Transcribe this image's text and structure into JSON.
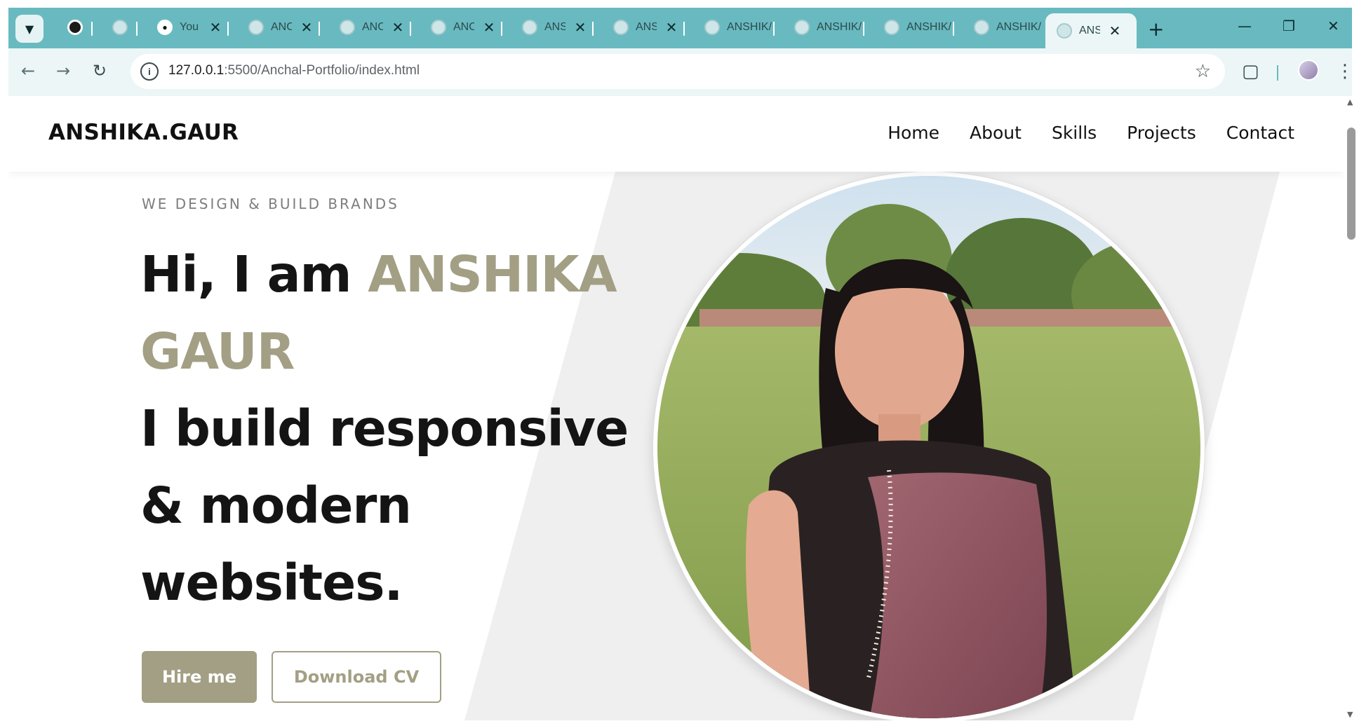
{
  "browser": {
    "tabs": [
      {
        "icon": "chatgpt-icon",
        "title": ""
      },
      {
        "icon": "globe-icon",
        "title": ""
      },
      {
        "icon": "github-icon",
        "title": "You"
      },
      {
        "icon": "globe-icon",
        "title": "ANC"
      },
      {
        "icon": "globe-icon",
        "title": "ANC"
      },
      {
        "icon": "globe-icon",
        "title": "ANC"
      },
      {
        "icon": "globe-icon",
        "title": "ANS"
      },
      {
        "icon": "globe-icon",
        "title": "ANS"
      },
      {
        "icon": "globe-icon",
        "title": "ANSHIK/"
      },
      {
        "icon": "globe-icon",
        "title": "ANSHIK/"
      },
      {
        "icon": "globe-icon",
        "title": "ANSHIK/"
      },
      {
        "icon": "globe-icon",
        "title": "ANSHIK/"
      },
      {
        "icon": "globe-icon",
        "title": "ANS"
      }
    ],
    "url_host": "127.0.0.1",
    "url_path": ":5500/Anchal-Portfolio/index.html",
    "tabstrip_color": "#68bac0"
  },
  "site": {
    "logo": "ANSHIKA.GAUR",
    "nav": [
      "Home",
      "About",
      "Skills",
      "Projects",
      "Contact"
    ],
    "tagline": "WE DESIGN & BUILD BRANDS",
    "headline_prefix": "Hi, I am ",
    "headline_name_1": "ANSHIKA",
    "headline_name_2": "GAUR",
    "headline_line_3": "I build responsive",
    "headline_line_4": "& modern",
    "headline_line_5": "websites.",
    "hire_label": "Hire me",
    "cv_label": "Download CV",
    "accent_color": "#a39f84"
  }
}
